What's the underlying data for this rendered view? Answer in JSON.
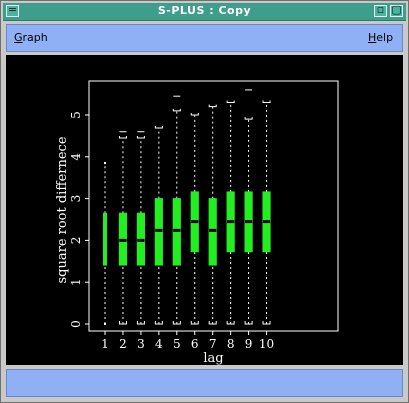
{
  "window": {
    "title": "S-PLUS : Copy",
    "controls": {
      "menu": "=",
      "minimize": "▫",
      "maximize": "▢"
    }
  },
  "menubar": {
    "graph_prefix": "G",
    "graph_rest": "raph",
    "help_prefix": "H",
    "help_rest": "elp"
  },
  "colors": {
    "titlebar": "#3f9d8c",
    "menubar": "#8fb0f4",
    "plot_background": "#000000",
    "box_fill": "#22ee22",
    "foreground": "#ffffff"
  },
  "chart_data": {
    "type": "boxplot",
    "title": "",
    "xlabel": "lag",
    "ylabel": "square root differnece",
    "ylim": [
      0,
      5.3
    ],
    "y_ticks": [
      "0",
      "1",
      "2",
      "3",
      "4",
      "5"
    ],
    "categories": [
      "1",
      "2",
      "3",
      "4",
      "5",
      "6",
      "7",
      "8",
      "9",
      "10"
    ],
    "boxes": [
      {
        "lag": "1",
        "min": 0,
        "q1": 1.41,
        "median": 2.0,
        "q3": 2.65,
        "max": 3.85,
        "outliers": []
      },
      {
        "lag": "2",
        "min": 0,
        "q1": 1.41,
        "median": 2.0,
        "q3": 2.65,
        "max": 4.45,
        "outliers": [
          4.6
        ]
      },
      {
        "lag": "3",
        "min": 0,
        "q1": 1.41,
        "median": 2.0,
        "q3": 2.65,
        "max": 4.45,
        "outliers": [
          4.6
        ]
      },
      {
        "lag": "4",
        "min": 0,
        "q1": 1.41,
        "median": 2.24,
        "q3": 3.0,
        "max": 4.69,
        "outliers": []
      },
      {
        "lag": "5",
        "min": 0,
        "q1": 1.41,
        "median": 2.24,
        "q3": 3.0,
        "max": 5.1,
        "outliers": [
          5.45
        ]
      },
      {
        "lag": "6",
        "min": 0,
        "q1": 1.73,
        "median": 2.45,
        "q3": 3.16,
        "max": 5.0,
        "outliers": []
      },
      {
        "lag": "7",
        "min": 0,
        "q1": 1.41,
        "median": 2.24,
        "q3": 3.0,
        "max": 5.2,
        "outliers": []
      },
      {
        "lag": "8",
        "min": 0,
        "q1": 1.73,
        "median": 2.45,
        "q3": 3.16,
        "max": 5.3,
        "outliers": []
      },
      {
        "lag": "9",
        "min": 0,
        "q1": 1.73,
        "median": 2.45,
        "q3": 3.16,
        "max": 4.9,
        "outliers": [
          5.6
        ]
      },
      {
        "lag": "10",
        "min": 0,
        "q1": 1.73,
        "median": 2.45,
        "q3": 3.16,
        "max": 5.3,
        "outliers": []
      }
    ]
  }
}
